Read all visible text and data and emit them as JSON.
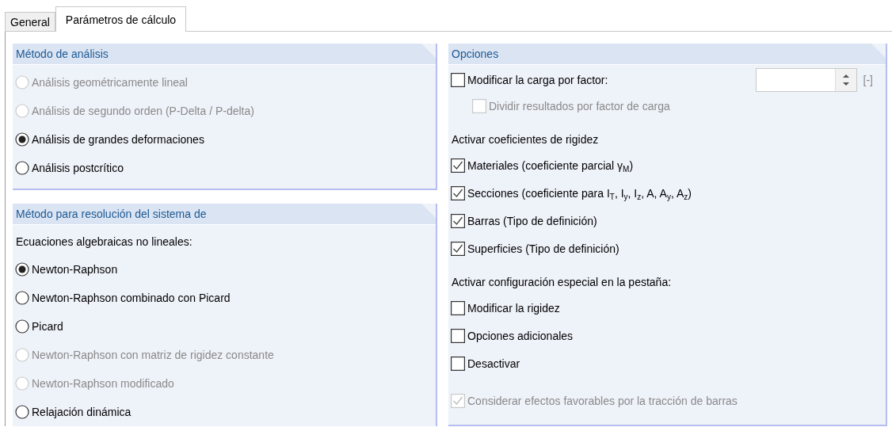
{
  "tabs": [
    {
      "label": "General",
      "selected": false
    },
    {
      "label": "Parámetros de cálculo",
      "selected": true
    }
  ],
  "analysis_method": {
    "title": "Método de análisis",
    "options": [
      {
        "label": "Análisis geométricamente lineal",
        "selected": false,
        "disabled": true
      },
      {
        "label": "Análisis de segundo orden (P-Delta / P-delta)",
        "selected": false,
        "disabled": true
      },
      {
        "label": "Análisis de grandes deformaciones",
        "selected": true,
        "disabled": false
      },
      {
        "label": "Análisis postcrítico",
        "selected": false,
        "disabled": false
      }
    ]
  },
  "solver_method": {
    "title": "Método para resolución del sistema de",
    "subtitle": "Ecuaciones algebraicas no lineales:",
    "options": [
      {
        "label": "Newton-Raphson",
        "selected": true,
        "disabled": false
      },
      {
        "label": "Newton-Raphson combinado con Picard",
        "selected": false,
        "disabled": false
      },
      {
        "label": "Picard",
        "selected": false,
        "disabled": false
      },
      {
        "label": "Newton-Raphson con matriz de rigidez constante",
        "selected": false,
        "disabled": true
      },
      {
        "label": "Newton-Raphson modificado",
        "selected": false,
        "disabled": true
      },
      {
        "label": "Relajación dinámica",
        "selected": false,
        "disabled": false
      }
    ]
  },
  "options": {
    "title": "Opciones",
    "items": [
      {
        "kind": "check",
        "label": "Modificar la carga por factor:",
        "checked": false,
        "disabled": false,
        "unit": "[-]",
        "children": [
          {
            "kind": "check",
            "label": "Dividir resultados por factor de carga",
            "checked": false,
            "disabled": true
          }
        ]
      },
      {
        "kind": "heading",
        "label": "Activar coeficientes de rigidez"
      },
      {
        "kind": "check",
        "label": "Materiales (coeficiente parcial γ$_{M}$)",
        "checked": true,
        "disabled": false
      },
      {
        "kind": "check",
        "label": "Secciones (coeficiente para I$_{T}$, I$_{y}$, I$_{z}$, A, A$_{y}$, A$_{z}$)",
        "checked": true,
        "disabled": false
      },
      {
        "kind": "check",
        "label": "Barras (Tipo de definición)",
        "checked": true,
        "disabled": false
      },
      {
        "kind": "check",
        "label": "Superficies (Tipo de definición)",
        "checked": true,
        "disabled": false
      },
      {
        "kind": "heading",
        "label": "Activar configuración especial en la pestaña:"
      },
      {
        "kind": "check",
        "label": "Modificar la rigidez",
        "checked": false,
        "disabled": false
      },
      {
        "kind": "check",
        "label": "Opciones adicionales",
        "checked": false,
        "disabled": false
      },
      {
        "kind": "check",
        "label": "Desactivar",
        "checked": false,
        "disabled": false
      },
      {
        "kind": "check",
        "label": "Considerar efectos favorables por la tracción de barras",
        "checked": true,
        "disabled": true
      }
    ]
  }
}
